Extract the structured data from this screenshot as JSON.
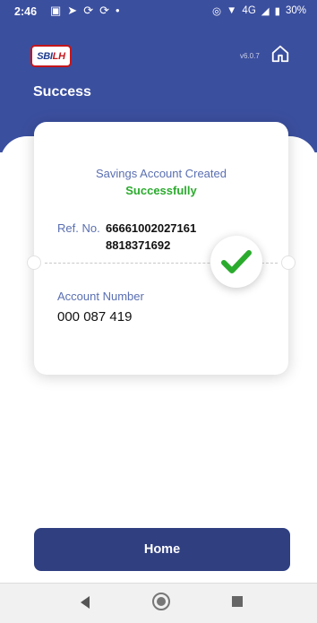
{
  "status_bar": {
    "time": "2:46",
    "left_icons": [
      "gallery-icon",
      "send-icon",
      "sync-icon",
      "sync-icon",
      "dot-icon"
    ],
    "network": "4G",
    "battery": "30%"
  },
  "app": {
    "logo_sbi": "SBI",
    "logo_lh": "LH",
    "version": "v6.0.7",
    "title": "Success"
  },
  "card": {
    "message_line1": "Savings Account Created",
    "message_line2": "Successfully",
    "ref_label": "Ref. No.",
    "ref_line1": "66661002027161",
    "ref_line2": "8818371692",
    "account_label": "Account Number",
    "account_value": "000 087 419"
  },
  "actions": {
    "home_button": "Home"
  },
  "colors": {
    "header_blue": "#3b4f9f",
    "button_blue": "#2f3f80",
    "success_green": "#2bab2d",
    "label_blue": "#5a6fb2"
  }
}
